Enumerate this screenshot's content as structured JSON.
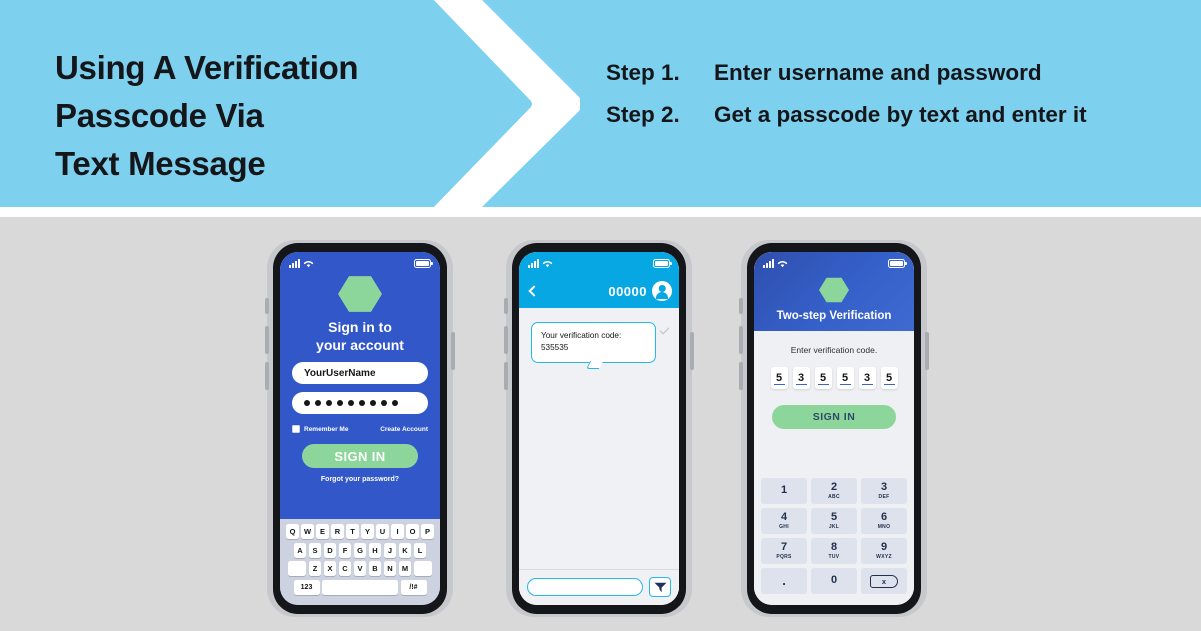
{
  "header": {
    "title_lines": [
      "Using A Verification",
      "Passcode Via",
      "Text Message"
    ],
    "chevron_icon": "chevron-right-icon",
    "band_color": "#7ed0ef",
    "steps": [
      {
        "label": "Step 1.",
        "text": "Enter username and password"
      },
      {
        "label": "Step 2.",
        "text": "Get a passcode by text and enter it"
      }
    ]
  },
  "phone_signin": {
    "status": {
      "signal_icon": "signal-bars-icon",
      "wifi_icon": "wifi-icon",
      "battery_icon": "battery-full-icon"
    },
    "logo_icon": "hexagon-logo-icon",
    "title_line1": "Sign in to",
    "title_line2": "your account",
    "username_value": "YourUserName",
    "username_placeholder": "YourUserName",
    "password_masked": "●●●●●●●●●",
    "remember_label": "Remember Me",
    "create_account_label": "Create Account",
    "signin_label": "SIGN IN",
    "forgot_label": "Forgot your password?",
    "bg_color": "#3257c8",
    "accent_green": "#8cd69b",
    "keyboard": {
      "row1": [
        "Q",
        "W",
        "E",
        "R",
        "T",
        "Y",
        "U",
        "I",
        "O",
        "P"
      ],
      "row2": [
        "A",
        "S",
        "D",
        "F",
        "G",
        "H",
        "J",
        "K",
        "L"
      ],
      "row3": [
        "Z",
        "X",
        "C",
        "V",
        "B",
        "N",
        "M"
      ],
      "numbers_key": "123",
      "space_key": "",
      "symbols_key": "/!#"
    }
  },
  "phone_messages": {
    "status": {
      "signal_icon": "signal-bars-icon",
      "wifi_icon": "wifi-icon",
      "battery_icon": "battery-full-icon"
    },
    "back_icon": "chevron-left-icon",
    "contact_number": "00000",
    "avatar_icon": "person-avatar-icon",
    "message_line1": "Your verification code:",
    "message_line2": "535535",
    "delivered_icon": "checkmark-icon",
    "input_value": "",
    "send_icon": "send-icon",
    "header_color": "#06a7e2",
    "bubble_border": "#29b6e8"
  },
  "phone_twostep": {
    "status": {
      "signal_icon": "signal-bars-icon",
      "wifi_icon": "wifi-icon",
      "battery_icon": "battery-full-icon"
    },
    "logo_icon": "hexagon-logo-icon",
    "title": "Two-step Verification",
    "prompt": "Enter verification code.",
    "code_digits": [
      "5",
      "3",
      "5",
      "5",
      "3",
      "5"
    ],
    "signin_label": "SIGN IN",
    "header_color": "#3560c9",
    "accent_green": "#8cd69b",
    "keypad": [
      [
        {
          "num": "1",
          "sub": ""
        },
        {
          "num": "2",
          "sub": "ABC"
        },
        {
          "num": "3",
          "sub": "DEF"
        }
      ],
      [
        {
          "num": "4",
          "sub": "GHI"
        },
        {
          "num": "5",
          "sub": "JKL"
        },
        {
          "num": "6",
          "sub": "MNO"
        }
      ],
      [
        {
          "num": "7",
          "sub": "PQRS"
        },
        {
          "num": "8",
          "sub": "TUV"
        },
        {
          "num": "9",
          "sub": "WXYZ"
        }
      ]
    ],
    "dot_key": ".",
    "zero_key": "0",
    "delete_key": "x",
    "delete_icon": "backspace-icon"
  },
  "page": {
    "background": "#d9d9d9"
  }
}
